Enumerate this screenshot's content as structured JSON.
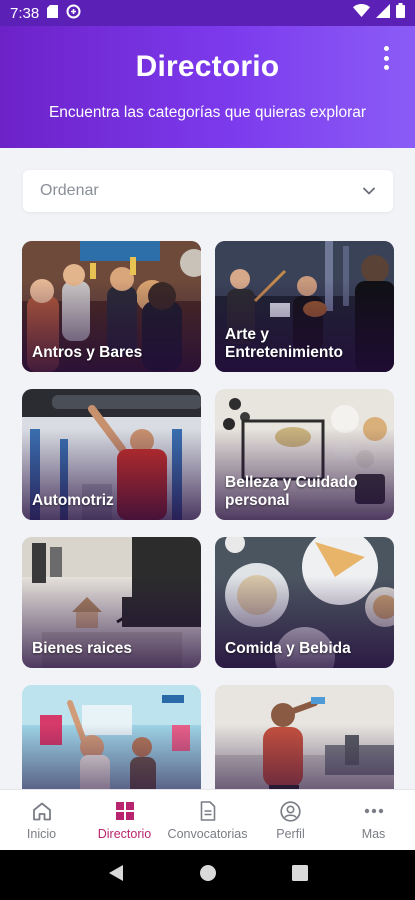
{
  "status_bar": {
    "time": "7:38"
  },
  "header": {
    "title": "Directorio",
    "subtitle": "Encuentra las categorías que quieras explorar"
  },
  "sort": {
    "label": "Ordenar"
  },
  "categories": [
    {
      "label": "Antros y Bares"
    },
    {
      "label": "Arte y Entretenimiento"
    },
    {
      "label": "Automotriz"
    },
    {
      "label": "Belleza y Cuidado personal"
    },
    {
      "label": "Bienes raices"
    },
    {
      "label": "Comida y Bebida"
    },
    {
      "label": ""
    },
    {
      "label": ""
    }
  ],
  "bottom_nav": {
    "items": [
      {
        "label": "Inicio",
        "icon": "home-icon"
      },
      {
        "label": "Directorio",
        "icon": "grid-icon",
        "active": true
      },
      {
        "label": "Convocatorias",
        "icon": "document-icon"
      },
      {
        "label": "Perfil",
        "icon": "profile-icon"
      },
      {
        "label": "Mas",
        "icon": "more-icon"
      }
    ]
  },
  "colors": {
    "header_start": "#6d22c8",
    "header_end": "#8b5cf6",
    "active_nav": "#b8246e"
  }
}
